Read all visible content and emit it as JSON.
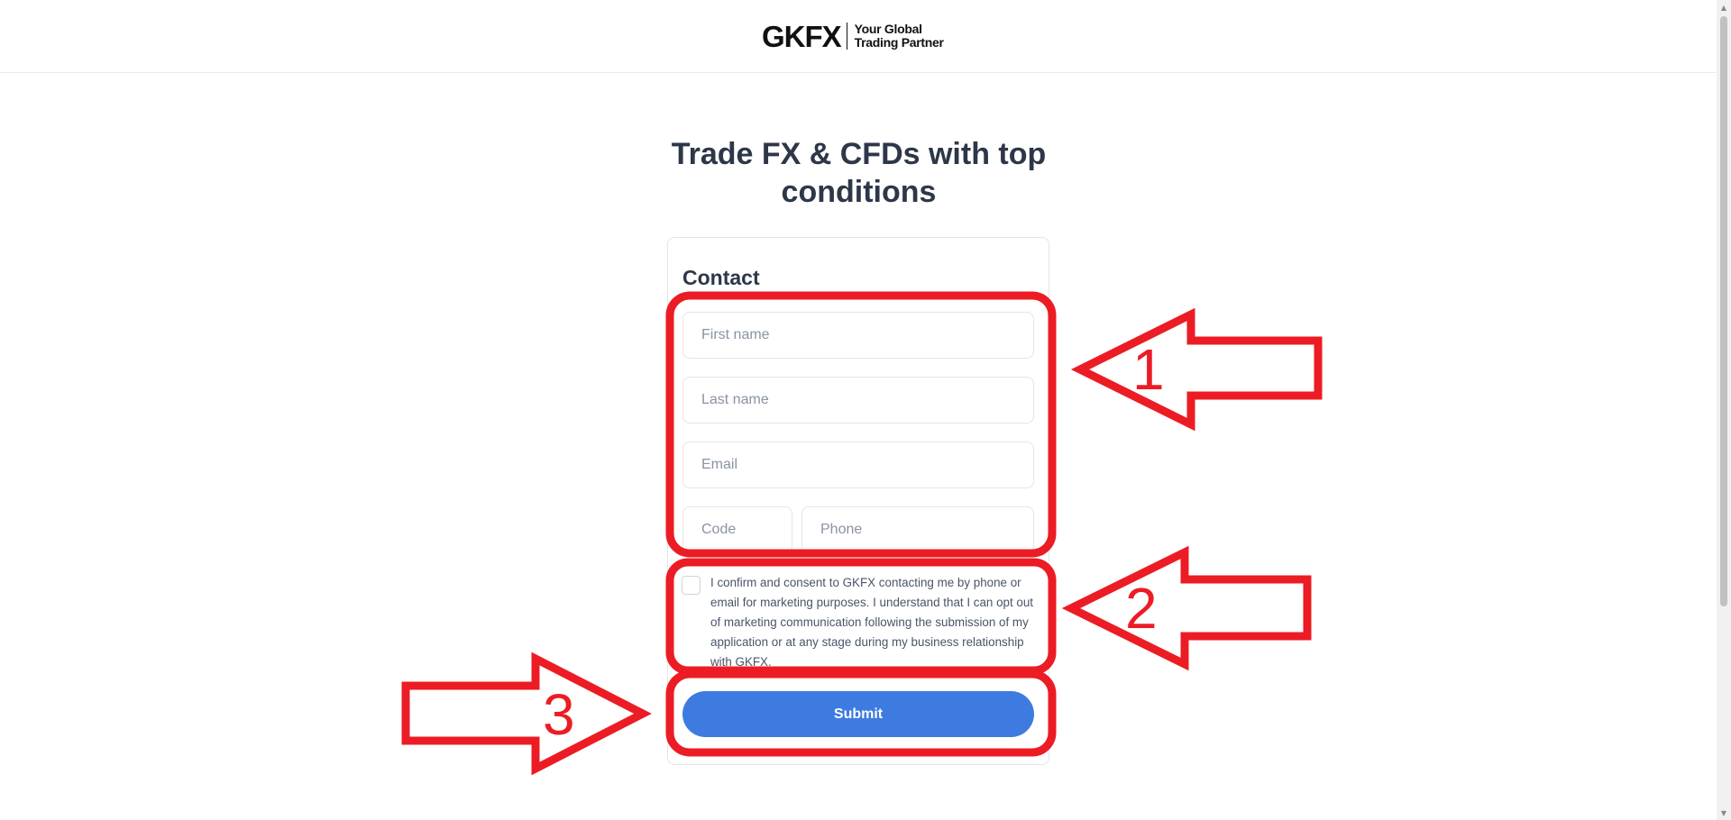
{
  "header": {
    "logo_mark": "GKFX",
    "tagline_line1": "Your Global",
    "tagline_line2": "Trading Partner"
  },
  "headline": {
    "line1": "Trade FX & CFDs with top",
    "line2": "conditions"
  },
  "form": {
    "title": "Contact",
    "first_name_placeholder": "First name",
    "last_name_placeholder": "Last name",
    "email_placeholder": "Email",
    "code_placeholder": "Code",
    "phone_placeholder": "Phone",
    "consent_text": "I confirm and consent to GKFX contacting me by phone or email for marketing purposes. I understand that I can opt out of marketing communication following the submission of my application or at any stage during my business relationship with GKFX.",
    "submit_label": "Submit"
  },
  "annotations": {
    "step1": "1",
    "step2": "2",
    "step3": "3",
    "color": "#ec1c24"
  },
  "colors": {
    "submit_button": "#3e7be0",
    "headline_text": "#2d3748"
  }
}
